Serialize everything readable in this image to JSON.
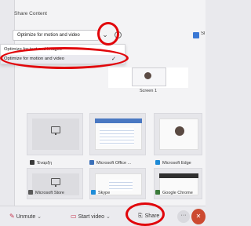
{
  "panel": {
    "title": "Share Content",
    "optimize_select": {
      "value": "Optimize for motion and video"
    },
    "info_icon": "i",
    "include_sound_label": "Sl"
  },
  "menu": {
    "items": [
      {
        "label": "Optimize for text and images",
        "selected": false
      },
      {
        "label": "Optimize for motion and video",
        "selected": true
      }
    ],
    "check_glyph": "✓"
  },
  "screens": [
    {
      "label": "Screen 1"
    }
  ],
  "windows": [
    {
      "label": "Έναρξη",
      "icon": "start-app-icon",
      "icon_color": "#3a3a3a"
    },
    {
      "label": "Microsoft Office ...",
      "icon": "office-icon",
      "icon_color": "#3a6fb8"
    },
    {
      "label": "Microsoft Edge",
      "icon": "edge-icon",
      "icon_color": "#1d8ad6"
    },
    {
      "label": "Microsoft Store",
      "icon": "store-icon",
      "icon_color": "#5a5a5a"
    },
    {
      "label": "Skype",
      "icon": "skype-icon",
      "icon_color": "#1e8cd8"
    },
    {
      "label": "Google Chrome",
      "icon": "chrome-icon",
      "icon_color": "#3b7a3a"
    }
  ],
  "toolbar": {
    "unmute_label": "Unmute",
    "start_video_label": "Start video",
    "share_label": "Share",
    "more_label": "···",
    "chevron": "⌄"
  }
}
